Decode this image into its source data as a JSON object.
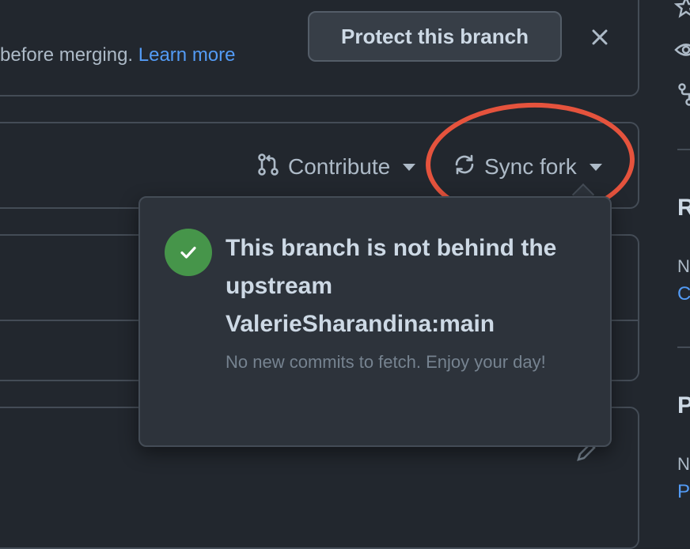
{
  "banner": {
    "text": "before merging. ",
    "link_label": "Learn more",
    "protect_button_label": "Protect this branch"
  },
  "toolbar": {
    "contribute_label": "Contribute",
    "sync_fork_label": "Sync fork"
  },
  "popover": {
    "title": "This branch is not behind the upstream ValerieSharandina:main",
    "description": "No new commits to fetch. Enjoy your day!"
  },
  "sidebar": {
    "section1_initial": "R",
    "section1_sub": "N",
    "section1_link": "C",
    "section2_initial": "P",
    "section2_sub": "N",
    "section2_link": "P"
  },
  "colors": {
    "background": "#22272e",
    "border": "#444c56",
    "link": "#539bf5",
    "success": "#46954a",
    "highlight_ring": "#e5533d"
  },
  "icons": [
    "close-icon",
    "git-pull-request-icon",
    "sync-icon",
    "chevron-down-icon",
    "check-icon",
    "pencil-icon",
    "star-icon",
    "eye-icon",
    "fork-icon"
  ]
}
